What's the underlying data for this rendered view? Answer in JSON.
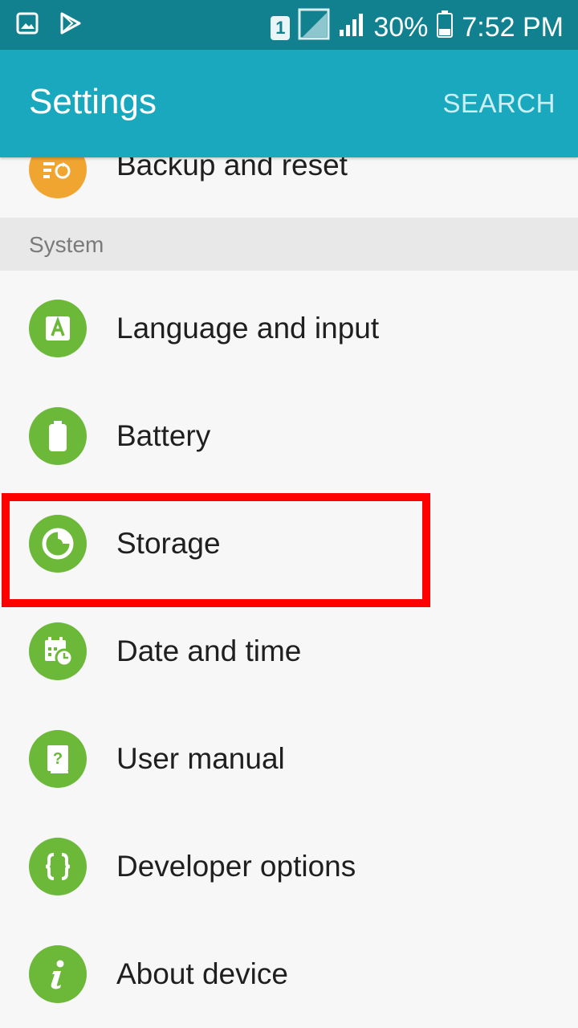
{
  "status_bar": {
    "sim_slot": "1",
    "battery_percent": "30%",
    "time": "7:52 PM",
    "left_icons": [
      "gallery-icon",
      "play-store-icon"
    ],
    "right_icons": [
      "sim-icon",
      "no-signal-icon",
      "signal-icon",
      "battery-icon"
    ]
  },
  "app_bar": {
    "title": "Settings",
    "search_label": "SEARCH"
  },
  "partial_item": {
    "label": "Backup and reset",
    "icon": "backup-icon",
    "color": "#f0a531"
  },
  "section": {
    "title": "System"
  },
  "items": [
    {
      "label": "Language and input",
      "icon": "language-icon"
    },
    {
      "label": "Battery",
      "icon": "battery-icon"
    },
    {
      "label": "Storage",
      "icon": "storage-icon"
    },
    {
      "label": "Date and time",
      "icon": "date-time-icon"
    },
    {
      "label": "User manual",
      "icon": "user-manual-icon"
    },
    {
      "label": "Developer options",
      "icon": "developer-options-icon"
    },
    {
      "label": "About device",
      "icon": "about-device-icon"
    }
  ],
  "colors": {
    "status_bar": "#11808f",
    "app_bar": "#1aa8bf",
    "icon_green": "#6cb93a",
    "highlight": "#ff0000"
  }
}
